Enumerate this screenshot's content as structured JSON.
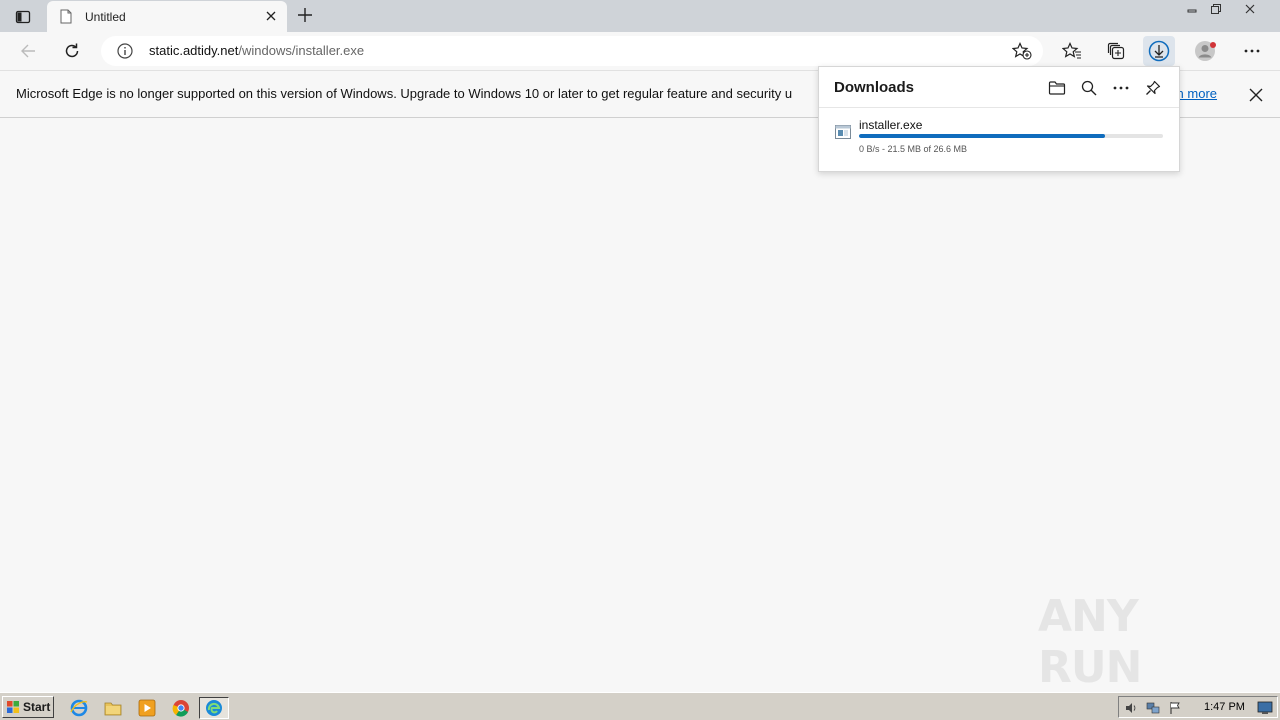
{
  "tab": {
    "title": "Untitled"
  },
  "addressbar": {
    "host": "static.adtidy.net",
    "path": "/windows/installer.exe"
  },
  "infobar": {
    "message": "Microsoft Edge is no longer supported on this version of Windows. Upgrade to Windows 10 or later to get regular feature and security u",
    "link_label": "arn more"
  },
  "downloads": {
    "title": "Downloads",
    "items": [
      {
        "file_name": "installer.exe",
        "progress_percent": 81,
        "status": "0 B/s - 21.5 MB of 26.6 MB"
      }
    ]
  },
  "watermark": {
    "text": "ANY RUN"
  },
  "taskbar": {
    "start_label": "Start",
    "clock": "1:47 PM"
  },
  "colors": {
    "accent": "#0f6cbd",
    "link": "#0060c0",
    "tab_bar": "#cfd3d8",
    "taskbar": "#d4d0c8"
  },
  "icons": [
    "tab-actions-icon",
    "page-icon",
    "close-icon",
    "plus-icon",
    "minimize-icon",
    "restore-icon",
    "back-icon",
    "refresh-icon",
    "info-icon",
    "add-favorite-icon",
    "favorites-icon",
    "collections-icon",
    "download-icon",
    "profile-icon",
    "more-icon",
    "folder-icon",
    "search-icon",
    "pin-icon",
    "exe-file-icon",
    "ie-icon",
    "explorer-icon",
    "media-player-icon",
    "chrome-icon",
    "edge-icon",
    "volume-icon",
    "network-icon",
    "flag-icon",
    "display-icon"
  ]
}
